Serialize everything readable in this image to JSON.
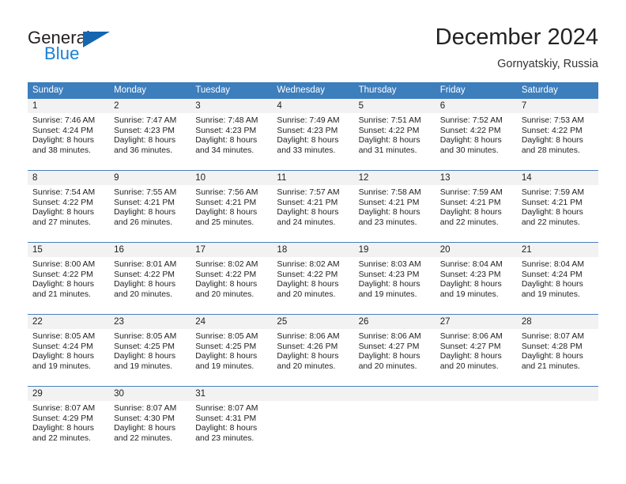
{
  "brand": {
    "line1": "General",
    "line2": "Blue",
    "logo_icon": "triangle-logo-icon",
    "colors": {
      "general_text": "#231f20",
      "blue_text": "#1a7fd4",
      "triangle": "#1565b0"
    }
  },
  "header": {
    "title": "December 2024",
    "subtitle": "Gornyatskiy, Russia"
  },
  "theme": {
    "header_row_bg": "#3d7ebd",
    "header_row_text": "#ffffff",
    "daynum_band_bg": "#f2f2f2",
    "week_divider": "#4a7fbc",
    "body_text": "#222222"
  },
  "calendar": {
    "weekday_headers": [
      "Sunday",
      "Monday",
      "Tuesday",
      "Wednesday",
      "Thursday",
      "Friday",
      "Saturday"
    ],
    "weeks": [
      [
        {
          "day": "1",
          "sunrise": "Sunrise: 7:46 AM",
          "sunset": "Sunset: 4:24 PM",
          "daylight": "Daylight: 8 hours",
          "daylight2": "and 38 minutes."
        },
        {
          "day": "2",
          "sunrise": "Sunrise: 7:47 AM",
          "sunset": "Sunset: 4:23 PM",
          "daylight": "Daylight: 8 hours",
          "daylight2": "and 36 minutes."
        },
        {
          "day": "3",
          "sunrise": "Sunrise: 7:48 AM",
          "sunset": "Sunset: 4:23 PM",
          "daylight": "Daylight: 8 hours",
          "daylight2": "and 34 minutes."
        },
        {
          "day": "4",
          "sunrise": "Sunrise: 7:49 AM",
          "sunset": "Sunset: 4:23 PM",
          "daylight": "Daylight: 8 hours",
          "daylight2": "and 33 minutes."
        },
        {
          "day": "5",
          "sunrise": "Sunrise: 7:51 AM",
          "sunset": "Sunset: 4:22 PM",
          "daylight": "Daylight: 8 hours",
          "daylight2": "and 31 minutes."
        },
        {
          "day": "6",
          "sunrise": "Sunrise: 7:52 AM",
          "sunset": "Sunset: 4:22 PM",
          "daylight": "Daylight: 8 hours",
          "daylight2": "and 30 minutes."
        },
        {
          "day": "7",
          "sunrise": "Sunrise: 7:53 AM",
          "sunset": "Sunset: 4:22 PM",
          "daylight": "Daylight: 8 hours",
          "daylight2": "and 28 minutes."
        }
      ],
      [
        {
          "day": "8",
          "sunrise": "Sunrise: 7:54 AM",
          "sunset": "Sunset: 4:22 PM",
          "daylight": "Daylight: 8 hours",
          "daylight2": "and 27 minutes."
        },
        {
          "day": "9",
          "sunrise": "Sunrise: 7:55 AM",
          "sunset": "Sunset: 4:21 PM",
          "daylight": "Daylight: 8 hours",
          "daylight2": "and 26 minutes."
        },
        {
          "day": "10",
          "sunrise": "Sunrise: 7:56 AM",
          "sunset": "Sunset: 4:21 PM",
          "daylight": "Daylight: 8 hours",
          "daylight2": "and 25 minutes."
        },
        {
          "day": "11",
          "sunrise": "Sunrise: 7:57 AM",
          "sunset": "Sunset: 4:21 PM",
          "daylight": "Daylight: 8 hours",
          "daylight2": "and 24 minutes."
        },
        {
          "day": "12",
          "sunrise": "Sunrise: 7:58 AM",
          "sunset": "Sunset: 4:21 PM",
          "daylight": "Daylight: 8 hours",
          "daylight2": "and 23 minutes."
        },
        {
          "day": "13",
          "sunrise": "Sunrise: 7:59 AM",
          "sunset": "Sunset: 4:21 PM",
          "daylight": "Daylight: 8 hours",
          "daylight2": "and 22 minutes."
        },
        {
          "day": "14",
          "sunrise": "Sunrise: 7:59 AM",
          "sunset": "Sunset: 4:21 PM",
          "daylight": "Daylight: 8 hours",
          "daylight2": "and 22 minutes."
        }
      ],
      [
        {
          "day": "15",
          "sunrise": "Sunrise: 8:00 AM",
          "sunset": "Sunset: 4:22 PM",
          "daylight": "Daylight: 8 hours",
          "daylight2": "and 21 minutes."
        },
        {
          "day": "16",
          "sunrise": "Sunrise: 8:01 AM",
          "sunset": "Sunset: 4:22 PM",
          "daylight": "Daylight: 8 hours",
          "daylight2": "and 20 minutes."
        },
        {
          "day": "17",
          "sunrise": "Sunrise: 8:02 AM",
          "sunset": "Sunset: 4:22 PM",
          "daylight": "Daylight: 8 hours",
          "daylight2": "and 20 minutes."
        },
        {
          "day": "18",
          "sunrise": "Sunrise: 8:02 AM",
          "sunset": "Sunset: 4:22 PM",
          "daylight": "Daylight: 8 hours",
          "daylight2": "and 20 minutes."
        },
        {
          "day": "19",
          "sunrise": "Sunrise: 8:03 AM",
          "sunset": "Sunset: 4:23 PM",
          "daylight": "Daylight: 8 hours",
          "daylight2": "and 19 minutes."
        },
        {
          "day": "20",
          "sunrise": "Sunrise: 8:04 AM",
          "sunset": "Sunset: 4:23 PM",
          "daylight": "Daylight: 8 hours",
          "daylight2": "and 19 minutes."
        },
        {
          "day": "21",
          "sunrise": "Sunrise: 8:04 AM",
          "sunset": "Sunset: 4:24 PM",
          "daylight": "Daylight: 8 hours",
          "daylight2": "and 19 minutes."
        }
      ],
      [
        {
          "day": "22",
          "sunrise": "Sunrise: 8:05 AM",
          "sunset": "Sunset: 4:24 PM",
          "daylight": "Daylight: 8 hours",
          "daylight2": "and 19 minutes."
        },
        {
          "day": "23",
          "sunrise": "Sunrise: 8:05 AM",
          "sunset": "Sunset: 4:25 PM",
          "daylight": "Daylight: 8 hours",
          "daylight2": "and 19 minutes."
        },
        {
          "day": "24",
          "sunrise": "Sunrise: 8:05 AM",
          "sunset": "Sunset: 4:25 PM",
          "daylight": "Daylight: 8 hours",
          "daylight2": "and 19 minutes."
        },
        {
          "day": "25",
          "sunrise": "Sunrise: 8:06 AM",
          "sunset": "Sunset: 4:26 PM",
          "daylight": "Daylight: 8 hours",
          "daylight2": "and 20 minutes."
        },
        {
          "day": "26",
          "sunrise": "Sunrise: 8:06 AM",
          "sunset": "Sunset: 4:27 PM",
          "daylight": "Daylight: 8 hours",
          "daylight2": "and 20 minutes."
        },
        {
          "day": "27",
          "sunrise": "Sunrise: 8:06 AM",
          "sunset": "Sunset: 4:27 PM",
          "daylight": "Daylight: 8 hours",
          "daylight2": "and 20 minutes."
        },
        {
          "day": "28",
          "sunrise": "Sunrise: 8:07 AM",
          "sunset": "Sunset: 4:28 PM",
          "daylight": "Daylight: 8 hours",
          "daylight2": "and 21 minutes."
        }
      ],
      [
        {
          "day": "29",
          "sunrise": "Sunrise: 8:07 AM",
          "sunset": "Sunset: 4:29 PM",
          "daylight": "Daylight: 8 hours",
          "daylight2": "and 22 minutes."
        },
        {
          "day": "30",
          "sunrise": "Sunrise: 8:07 AM",
          "sunset": "Sunset: 4:30 PM",
          "daylight": "Daylight: 8 hours",
          "daylight2": "and 22 minutes."
        },
        {
          "day": "31",
          "sunrise": "Sunrise: 8:07 AM",
          "sunset": "Sunset: 4:31 PM",
          "daylight": "Daylight: 8 hours",
          "daylight2": "and 23 minutes."
        },
        {
          "day": "",
          "sunrise": "",
          "sunset": "",
          "daylight": "",
          "daylight2": ""
        },
        {
          "day": "",
          "sunrise": "",
          "sunset": "",
          "daylight": "",
          "daylight2": ""
        },
        {
          "day": "",
          "sunrise": "",
          "sunset": "",
          "daylight": "",
          "daylight2": ""
        },
        {
          "day": "",
          "sunrise": "",
          "sunset": "",
          "daylight": "",
          "daylight2": ""
        }
      ]
    ]
  }
}
